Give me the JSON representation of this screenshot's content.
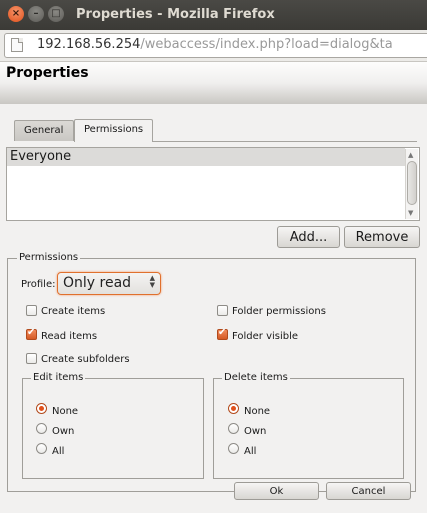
{
  "window": {
    "title": "Properties - Mozilla Firefox",
    "controls": {
      "close": "×",
      "minimize": "–",
      "maximize": "□"
    }
  },
  "urlbar": {
    "host": "192.168.56.254",
    "path": "/webaccess/index.php?load=dialog&ta"
  },
  "dialog": {
    "title": "Properties"
  },
  "tabs": [
    {
      "label": "General",
      "active": false
    },
    {
      "label": "Permissions",
      "active": true
    }
  ],
  "users": {
    "items": [
      "Everyone"
    ],
    "selected": "Everyone"
  },
  "user_buttons": {
    "add": "Add...",
    "remove": "Remove"
  },
  "permissions": {
    "legend": "Permissions",
    "profile_label": "Profile:",
    "profile_value": "Only read",
    "checkboxes": {
      "create_items": {
        "label": "Create items",
        "checked": false
      },
      "read_items": {
        "label": "Read items",
        "checked": true
      },
      "create_subfolders": {
        "label": "Create subfolders",
        "checked": false
      },
      "folder_permissions": {
        "label": "Folder permissions",
        "checked": false
      },
      "folder_visible": {
        "label": "Folder visible",
        "checked": true
      }
    },
    "edit_items": {
      "legend": "Edit items",
      "options": [
        "None",
        "Own",
        "All"
      ],
      "selected": "None"
    },
    "delete_items": {
      "legend": "Delete items",
      "options": [
        "None",
        "Own",
        "All"
      ],
      "selected": "None"
    }
  },
  "footer": {
    "ok": "Ok",
    "cancel": "Cancel"
  },
  "colors": {
    "accent": "#e0511c",
    "titlebar": "#3c3b37"
  }
}
